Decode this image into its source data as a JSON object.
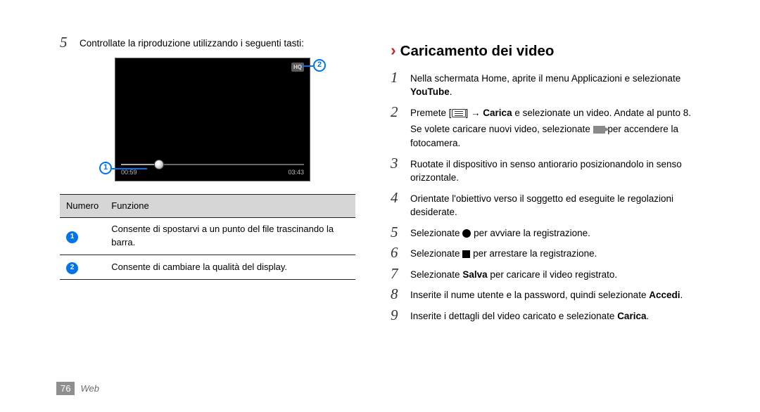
{
  "left": {
    "step5_intro": "Controllate la riproduzione utilizzando i seguenti tasti:",
    "video": {
      "hq_label": "HQ",
      "time_left": "00:59",
      "time_right": "03:43"
    },
    "table": {
      "col_num": "Numero",
      "col_func": "Funzione",
      "rows": [
        {
          "n": "1",
          "desc": "Consente di spostarvi a un punto del file trascinando la barra."
        },
        {
          "n": "2",
          "desc": "Consente di cambiare la qualità del display."
        }
      ]
    }
  },
  "right": {
    "heading": "Caricamento dei video",
    "steps": {
      "s1a": "Nella schermata Home, aprite il menu Applicazioni e selezionate ",
      "s1b": "YouTube",
      "s1c": ".",
      "s2a": "Premete [",
      "s2b": "] → ",
      "s2c": "Carica",
      "s2d": " e selezionate un video. Andate al punto 8.",
      "s2_note_a": "Se volete caricare nuovi video, selezionate ",
      "s2_note_b": " per accendere la fotocamera.",
      "s3": "Ruotate il dispositivo in senso antiorario posizionandolo in senso orizzontale.",
      "s4": "Orientate l'obiettivo verso il soggetto ed eseguite le regolazioni desiderate.",
      "s5a": "Selezionate ",
      "s5b": " per avviare la registrazione.",
      "s6a": "Selezionate ",
      "s6b": " per arrestare la registrazione.",
      "s7a": "Selezionate ",
      "s7b": "Salva",
      "s7c": " per caricare il video registrato.",
      "s8a": "Inserite il nume utente e la password, quindi selezionate ",
      "s8b": "Accedi",
      "s8c": ".",
      "s9a": "Inserite i dettagli del video caricato e selezionate ",
      "s9b": "Carica",
      "s9c": "."
    }
  },
  "footer": {
    "page": "76",
    "section": "Web"
  }
}
